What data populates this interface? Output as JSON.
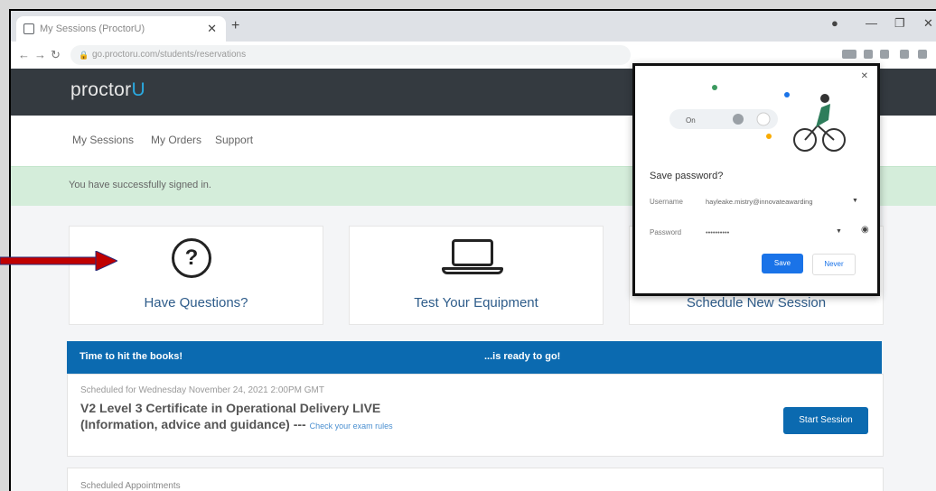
{
  "browser": {
    "tab_title": "My Sessions (ProctorU)",
    "tab_close": "✕",
    "new_tab": "+",
    "url": "go.proctoru.com/students/reservations"
  },
  "site": {
    "logo_main": "proctor",
    "logo_accent": "U",
    "nav": {
      "sessions": "My Sessions",
      "orders": "My Orders",
      "support": "Support"
    },
    "alert": "You have successfully signed in."
  },
  "cards": {
    "questions": "Have Questions?",
    "equipment": "Test Your Equipment",
    "schedule": "Schedule New Session"
  },
  "banner": {
    "left": "Time to hit the books!",
    "right": "...is ready to go!"
  },
  "session": {
    "scheduled": "Scheduled for Wednesday November 24, 2021 2:00PM GMT",
    "title_line1": "V2 Level 3 Certificate in Operational Delivery LIVE",
    "title_line2": "(Information, advice and guidance) ---",
    "rules_link": "Check your exam rules",
    "start_button": "Start Session"
  },
  "appointments": {
    "label": "Scheduled Appointments"
  },
  "password_popup": {
    "title": "Save password?",
    "username_label": "Username",
    "username_value": "hayleake.mistry@innovateawarding",
    "password_label": "Password",
    "password_value": "••••••••••",
    "save_button": "Save",
    "never_button": "Never",
    "close": "✕"
  },
  "colors": {
    "site_header": "#343a40",
    "accent_blue": "#0b6ab0",
    "success_bg": "#d4edda",
    "arrow_red": "#c00000",
    "chrome_save": "#1a73e8"
  }
}
